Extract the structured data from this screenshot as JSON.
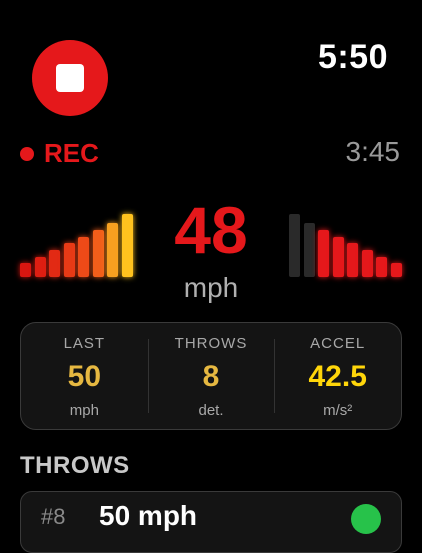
{
  "status_bar": {
    "time": "5:50"
  },
  "recording": {
    "label": "REC",
    "elapsed": "3:45"
  },
  "gauge": {
    "speed": "48",
    "unit": "mph",
    "left_bars": [
      {
        "level": 0.2,
        "color": "#d91610"
      },
      {
        "level": 0.28,
        "color": "#de1e12"
      },
      {
        "level": 0.37,
        "color": "#e22a14"
      },
      {
        "level": 0.47,
        "color": "#e83a16"
      },
      {
        "level": 0.56,
        "color": "#ee4a18"
      },
      {
        "level": 0.65,
        "color": "#f25e1a"
      },
      {
        "level": 0.75,
        "color": "#f7a020"
      },
      {
        "level": 0.88,
        "color": "#ffc21e"
      }
    ],
    "right_bars": [
      {
        "level": 0.88,
        "color": "#2a2a2a"
      },
      {
        "level": 0.75,
        "color": "#2a2a2a"
      },
      {
        "level": 0.65,
        "color": "#e5181b"
      },
      {
        "level": 0.56,
        "color": "#e5181b"
      },
      {
        "level": 0.47,
        "color": "#e5181b"
      },
      {
        "level": 0.37,
        "color": "#e5181b"
      },
      {
        "level": 0.28,
        "color": "#e5181b"
      },
      {
        "level": 0.2,
        "color": "#e5181b"
      }
    ]
  },
  "stats": [
    {
      "title": "LAST",
      "value": "50",
      "unit": "mph",
      "color": "#e6b841"
    },
    {
      "title": "THROWS",
      "value": "8",
      "unit": "det.",
      "color": "#e6b841"
    },
    {
      "title": "ACCEL",
      "value": "42.5",
      "unit": "m/s²",
      "color": "#ffd60a"
    }
  ],
  "throws": {
    "title": "THROWS",
    "items": [
      {
        "number": "#8",
        "speed": "50 mph"
      }
    ]
  },
  "colors": {
    "accent": "#e5181b",
    "success": "#27c24a"
  }
}
